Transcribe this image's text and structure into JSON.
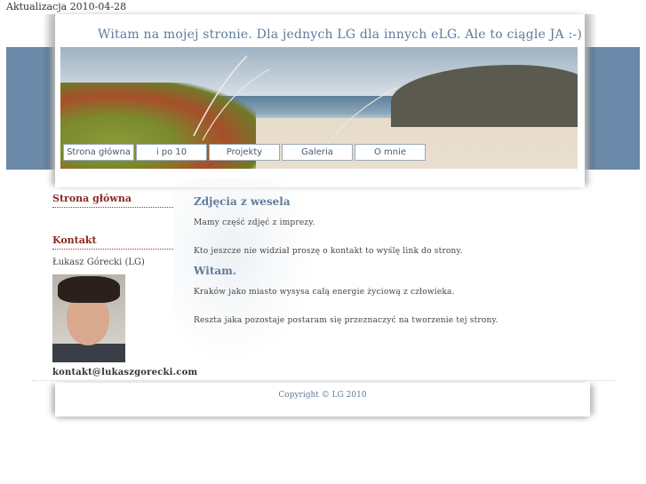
{
  "update_stamp": "Aktualizacja 2010-04-28",
  "header": {
    "welcome": "Witam na mojej stronie. Dla jednych LG dla innych eLG. Ale to ciągle JA :-)"
  },
  "nav": {
    "items": [
      {
        "label": "Strona główna"
      },
      {
        "label": "i po 10"
      },
      {
        "label": "Projekty"
      },
      {
        "label": "Galeria"
      },
      {
        "label": "O mnie"
      }
    ]
  },
  "sidebar": {
    "home_heading": "Strona główna",
    "contact_heading": "Kontakt",
    "name": "Łukasz Górecki (LG)",
    "email": "kontakt@lukaszgorecki.com"
  },
  "content": {
    "sections": [
      {
        "title": "Zdjęcia z wesela",
        "paragraphs": [
          "Mamy część zdjęć z imprezy.",
          "Kto jeszcze nie widział proszę o kontakt to wyślę link do strony."
        ]
      },
      {
        "title": "Witam.",
        "paragraphs": [
          "Kraków jako miasto wysysa całą energie życiową z człowieka.",
          "Reszta jaka pozostaje postaram się przeznaczyć na tworzenie tej strony."
        ]
      }
    ]
  },
  "footer": {
    "copyright": "Copyright © LG 2010"
  },
  "colors": {
    "band": "#6b89a8",
    "accent_blue": "#5f7c9a",
    "accent_red": "#8a2a22"
  }
}
